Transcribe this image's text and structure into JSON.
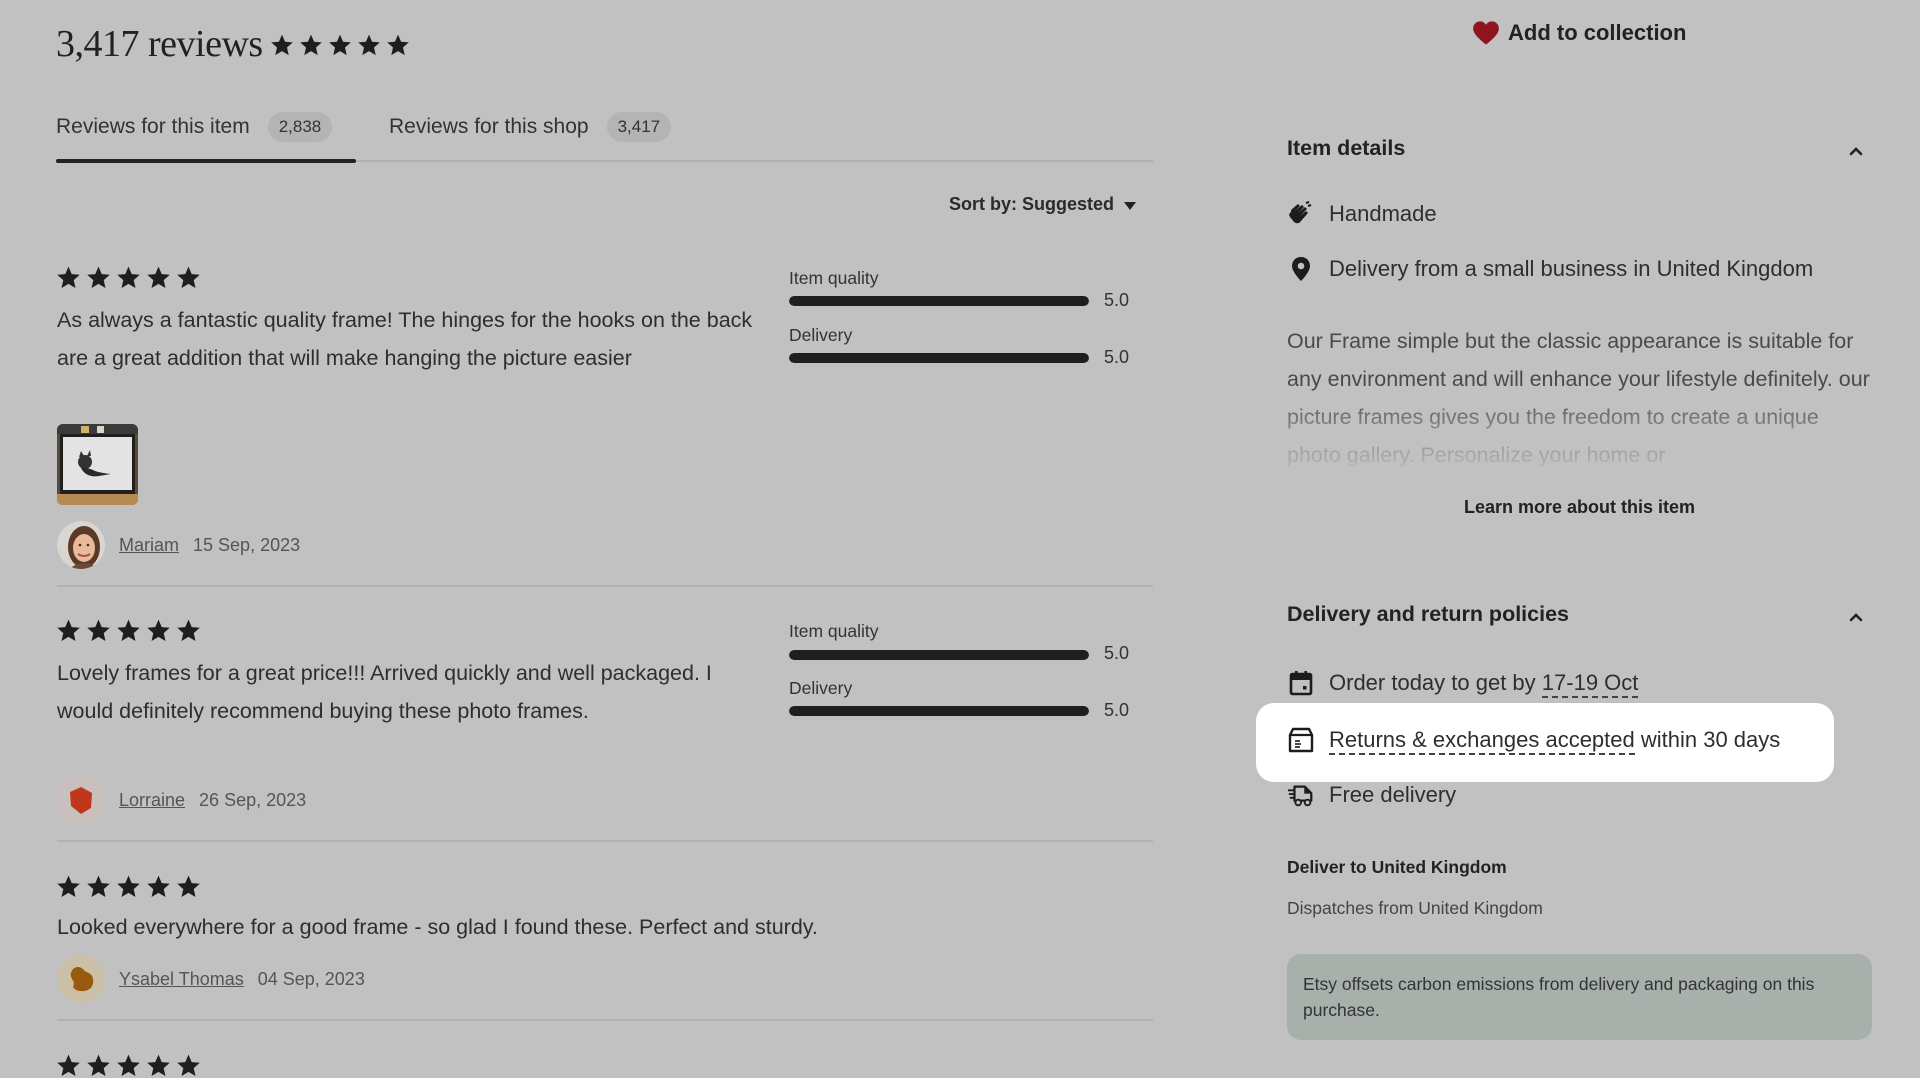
{
  "header": {
    "reviews_count_label": "3,417 reviews",
    "overall_rating": 5,
    "overall_rating_max": 5
  },
  "tabs": [
    {
      "label": "Reviews for this item",
      "count": "2,838",
      "active": true
    },
    {
      "label": "Reviews for this shop",
      "count": "3,417",
      "active": false
    }
  ],
  "sort": {
    "label": "Sort by: Suggested"
  },
  "reviews": [
    {
      "rating": 5,
      "text": "As always a fantastic quality frame! The hinges for the hooks on the back are a great addition that will make hanging the picture easier",
      "has_photo": true,
      "photo_alt": "framed drawing of a cat",
      "sub_ratings": [
        {
          "label": "Item quality",
          "value": "5.0",
          "fraction": 1.0
        },
        {
          "label": "Delivery",
          "value": "5.0",
          "fraction": 1.0
        }
      ],
      "reviewer": "Mariam",
      "date": "15 Sep, 2023",
      "avatar_type": "photo"
    },
    {
      "rating": 5,
      "text": "Lovely frames for a great price!!! Arrived quickly and well packaged. I would definitely recommend buying these photo frames.",
      "has_photo": false,
      "sub_ratings": [
        {
          "label": "Item quality",
          "value": "5.0",
          "fraction": 1.0
        },
        {
          "label": "Delivery",
          "value": "5.0",
          "fraction": 1.0
        }
      ],
      "reviewer": "Lorraine",
      "date": "26 Sep, 2023",
      "avatar_type": "shape",
      "avatar_color": "#c0371c",
      "avatar_bg": "#c9bfbd"
    },
    {
      "rating": 5,
      "text": "Looked everywhere for a good frame - so glad I found these. Perfect and sturdy.",
      "has_photo": false,
      "sub_ratings": [],
      "reviewer": "Ysabel Thomas",
      "date": "04 Sep, 2023",
      "avatar_type": "shape",
      "avatar_color": "#9a5a0e",
      "avatar_bg": "#cbbfa8"
    },
    {
      "rating": 5
    }
  ],
  "sidebar": {
    "add_to_collection": "Add to collection",
    "heart_color": "#8e1420",
    "item_details": {
      "title": "Item details",
      "expanded": true,
      "rows": [
        {
          "icon": "hand-icon",
          "label": "Handmade"
        },
        {
          "icon": "location-pin-icon",
          "label": "Delivery from a small business in United Kingdom"
        }
      ],
      "description": "Our Frame simple but the classic appearance is suitable for any environment and will enhance your lifestyle definitely. our picture frames gives you the freedom to create a unique photo gallery. Personalize your home or",
      "learn_more": "Learn more about this item"
    },
    "delivery": {
      "title": "Delivery and return policies",
      "expanded": true,
      "order_prefix": "Order today to get by ",
      "order_date": "17-19 Oct",
      "returns_link": "Returns & exchanges accepted",
      "returns_suffix": " within 30 days",
      "free_delivery": "Free delivery",
      "deliver_to": "Deliver to United Kingdom",
      "dispatches_from": "Dispatches from United Kingdom",
      "carbon_note": "Etsy offsets carbon emissions from delivery and packaging on this purchase.",
      "carbon_bg": "#a7b0aa"
    }
  }
}
